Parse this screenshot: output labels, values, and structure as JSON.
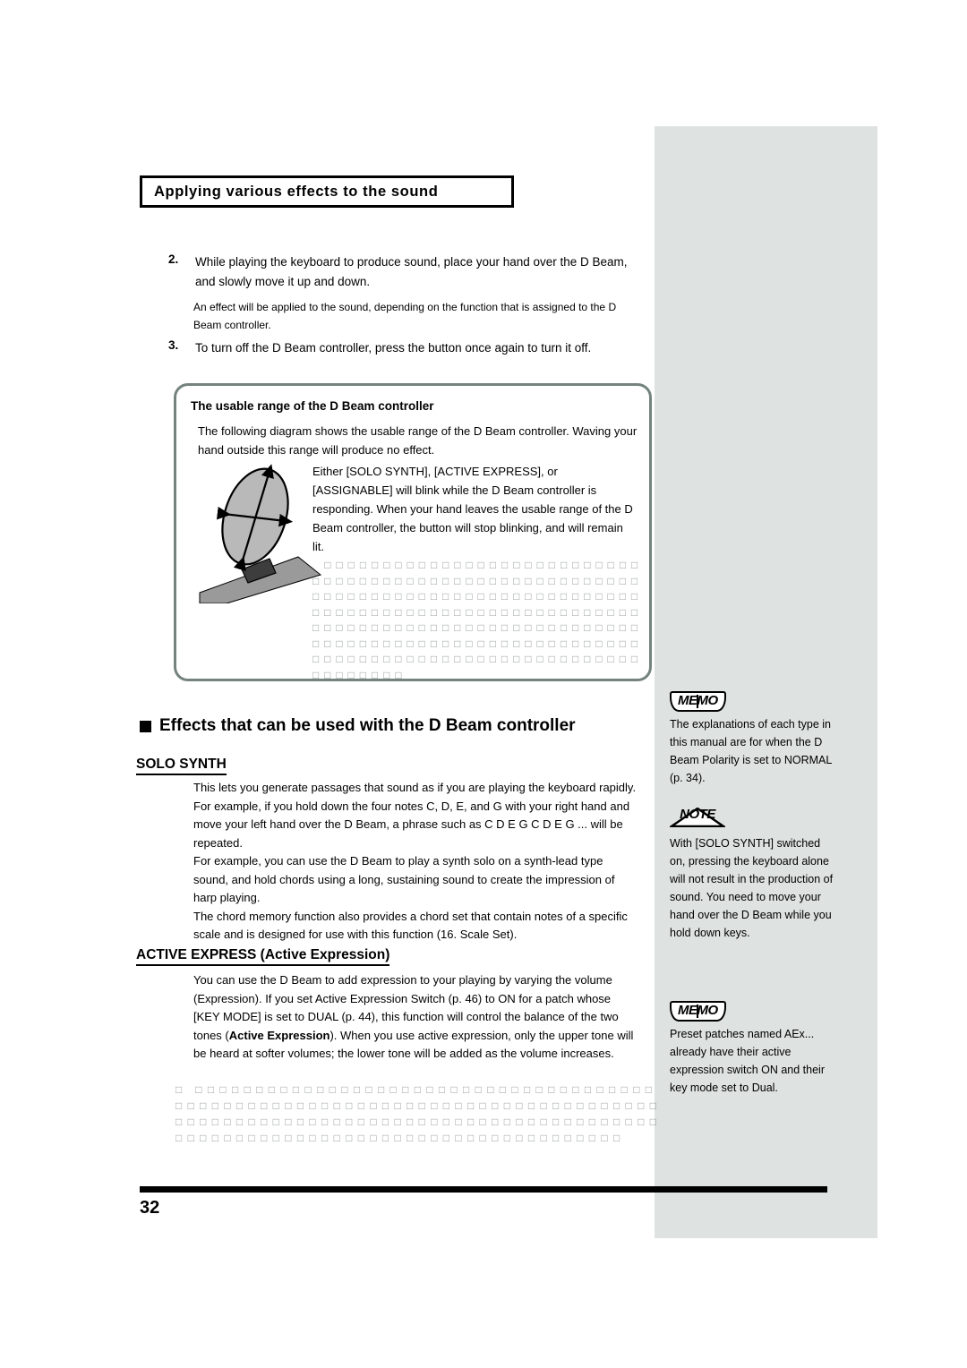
{
  "page": {
    "chapter_title": "Applying various effects to the sound",
    "page_number": "32"
  },
  "steps": [
    {
      "num": "2.",
      "text": "While playing the keyboard to produce sound, place your hand over the D Beam, and slowly move it up and down.",
      "sub": "An effect will be applied to the sound, depending on the function that is assigned to the D Beam controller."
    },
    {
      "num": "3.",
      "text": "To turn off the D Beam controller, press the button once again to turn it off.",
      "sub": ""
    }
  ],
  "usable_range_box": {
    "heading": "The usable range of the D Beam controller",
    "lead": "The following diagram shows the usable range of the D Beam controller. Waving your hand outside this range will produce no effect.",
    "figure_caption": "",
    "body": "Either [SOLO SYNTH], [ACTIVE EXPRESS], or [ASSIGNABLE] will blink while the D Beam controller is responding. When your hand leaves the usable range of the D Beam controller, the button will stop blinking, and will remain lit.",
    "unrendered_text": "　□ □ □ □ □ □ □ □ □ □ □ □ □ □ □ □ □ □ □ □ □ □ □ □ □ □ □ □ □ □ □ □ □ □ □ □ □ □ □ □ □ □ □ □ □ □ □ □ □ □ □ □ □ □ □ □ □ □ □ □ □ □ □ □ □ □ □ □ □ □ □ □ □ □ □ □ □ □ □ □ □ □ □ □ □ □ □ □ □ □ □ □ □ □ □ □ □ □ □ □ □ □ □ □ □ □ □ □ □ □ □ □ □ □ □ □ □ □ □ □ □ □ □ □ □ □ □ □ □ □ □ □ □ □ □ □ □ □ □ □ □ □ □ □ □ □ □ □ □ □ □ □ □ □ □ □ □ □ □ □ □ □ □ □ □ □ □ □ □ □ □ □ □ □ □ □ □ □ □ □ □ □ □ □ □ □ □ □ □ □ □ □ □ □ □ □ □ □ □ □ □ □ □"
  },
  "section": {
    "heading": "Effects that can be used with the D Beam controller",
    "subsections": [
      {
        "title": "SOLO SYNTH",
        "paragraphs": [
          "This lets you generate passages that sound as if you are playing the keyboard rapidly. For example, if you hold down the four notes C, D, E, and G with your right hand and move your left hand over the D Beam, a phrase such as  C D E G C D E G ...  will be repeated.",
          "For example, you can use the D Beam to play a synth solo on a synth-lead type sound, and hold chords using a long, sustaining sound to create the impression of harp playing.",
          "The chord memory function also provides a chord set that contain notes of a specific scale and is designed for use with this function (16. Scale Set)."
        ]
      },
      {
        "title": "ACTIVE EXPRESS (Active Expression)",
        "paragraphs_html": "You can use the D Beam to add expression to your playing by varying the volume (Expression). If you set Active Expression Switch (p. 46) to  ON  for a patch whose [KEY MODE] is set to  DUAL  (p. 44), this function will control the balance of the two tones (<b>Active Expression</b>). When you use active expression, only the upper tone will be heard at softer volumes; the lower tone will be added as the volume increases."
      }
    ]
  },
  "side_notes": [
    {
      "badge": "MEMO",
      "badge_icon": "open-book-icon",
      "text": "The explanations of each type in this manual are for when the D Beam Polarity is set to  NORMAL  (p. 34)."
    },
    {
      "badge": "NOTE",
      "badge_icon": "warning-triangle-icon",
      "text": "With [SOLO SYNTH] switched on, pressing the keyboard alone will not result in the production of sound. You need to move your hand over the D Beam while you hold down keys."
    },
    {
      "badge": "MEMO",
      "badge_icon": "open-book-icon",
      "text": "Preset patches named  AEx...  already have their active expression switch ON and their key mode set to Dual."
    }
  ],
  "unrendered_lower": "□　□ □ □ □ □ □ □ □ □ □ □ □ □ □ □ □ □ □ □ □ □ □ □ □ □ □ □ □ □ □ □ □ □ □ □ □ □ □ □ □ □ □ □ □ □ □ □ □ □ □ □ □ □ □ □ □ □ □ □ □ □ □ □ □ □ □ □ □ □ □ □ □ □ □ □ □ □ □ □ □ □ □ □ □ □ □ □ □ □ □ □ □ □ □ □ □ □ □ □ □ □ □ □ □ □ □ □ □ □ □ □ □ □ □ □ □ □ □ □ □ □ □ □ □ □ □ □ □ □ □ □ □ □ □ □ □ □ □ □ □ □ □ □ □ □ □ □ □ □ □ □ □ □ □ □"
}
